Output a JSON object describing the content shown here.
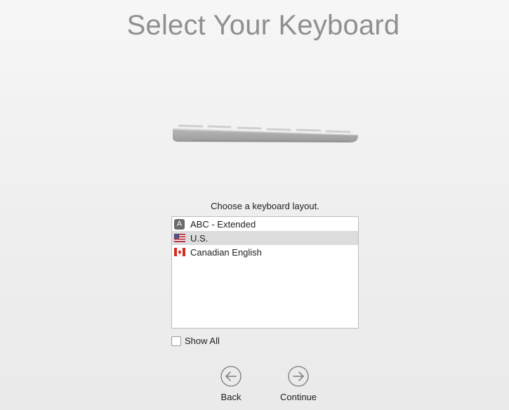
{
  "title": "Select Your Keyboard",
  "prompt": "Choose a keyboard layout.",
  "layouts": [
    {
      "label": "ABC - Extended",
      "icon": "abc-input-source-icon",
      "badge": "A",
      "selected": false
    },
    {
      "label": "U.S.",
      "icon": "us-flag-icon",
      "selected": true
    },
    {
      "label": "Canadian English",
      "icon": "canada-flag-icon",
      "selected": false
    }
  ],
  "show_all": {
    "label": "Show All",
    "checked": false
  },
  "nav": {
    "back_label": "Back",
    "continue_label": "Continue",
    "back_icon": "back-arrow-circle-icon",
    "continue_icon": "forward-arrow-circle-icon"
  },
  "colors": {
    "title": "#8f8f8f",
    "selection": "#dcdcdc",
    "list_border": "#bdbdbd"
  }
}
